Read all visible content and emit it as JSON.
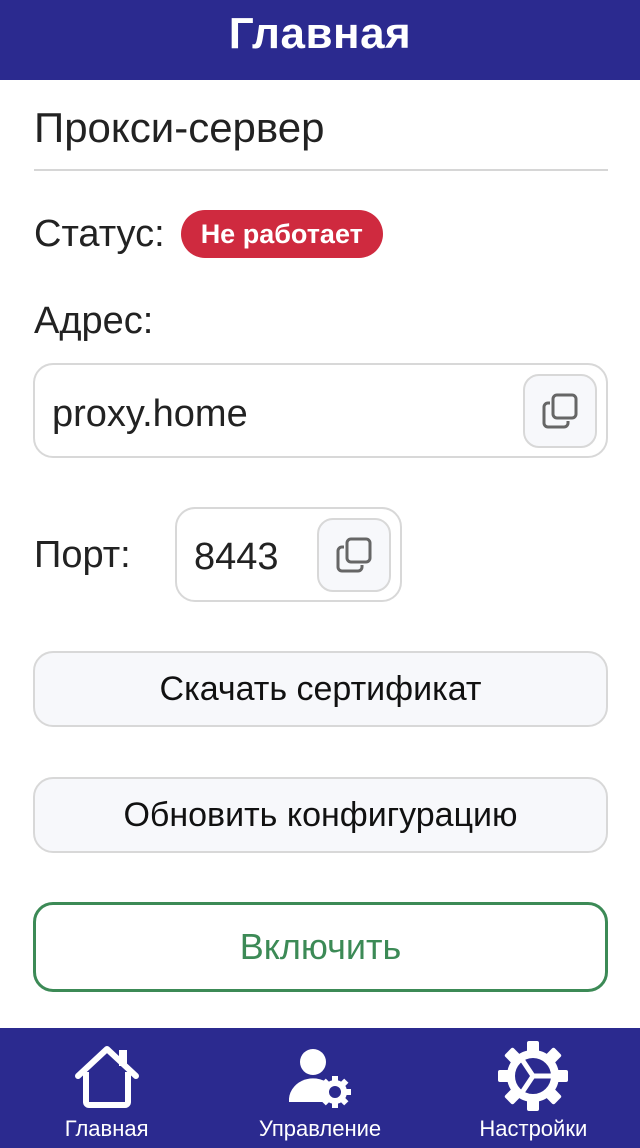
{
  "header": {
    "title": "Главная"
  },
  "proxy": {
    "section_title": "Прокси-сервер",
    "status_label": "Статус:",
    "status_value": "Не работает",
    "address_label": "Адрес:",
    "address_value": "proxy.home",
    "port_label": "Порт:",
    "port_value": "8443"
  },
  "actions": {
    "download_cert": "Скачать сертификат",
    "update_config": "Обновить конфигурацию",
    "enable": "Включить"
  },
  "nav": {
    "items": [
      {
        "label": "Главная",
        "icon": "home-icon"
      },
      {
        "label": "Управление",
        "icon": "user-cog-icon"
      },
      {
        "label": "Настройки",
        "icon": "settings-gear-icon"
      }
    ]
  },
  "colors": {
    "brand": "#2b2a8f",
    "status_error": "#cf2a3f",
    "enable_green": "#3c8a56"
  }
}
